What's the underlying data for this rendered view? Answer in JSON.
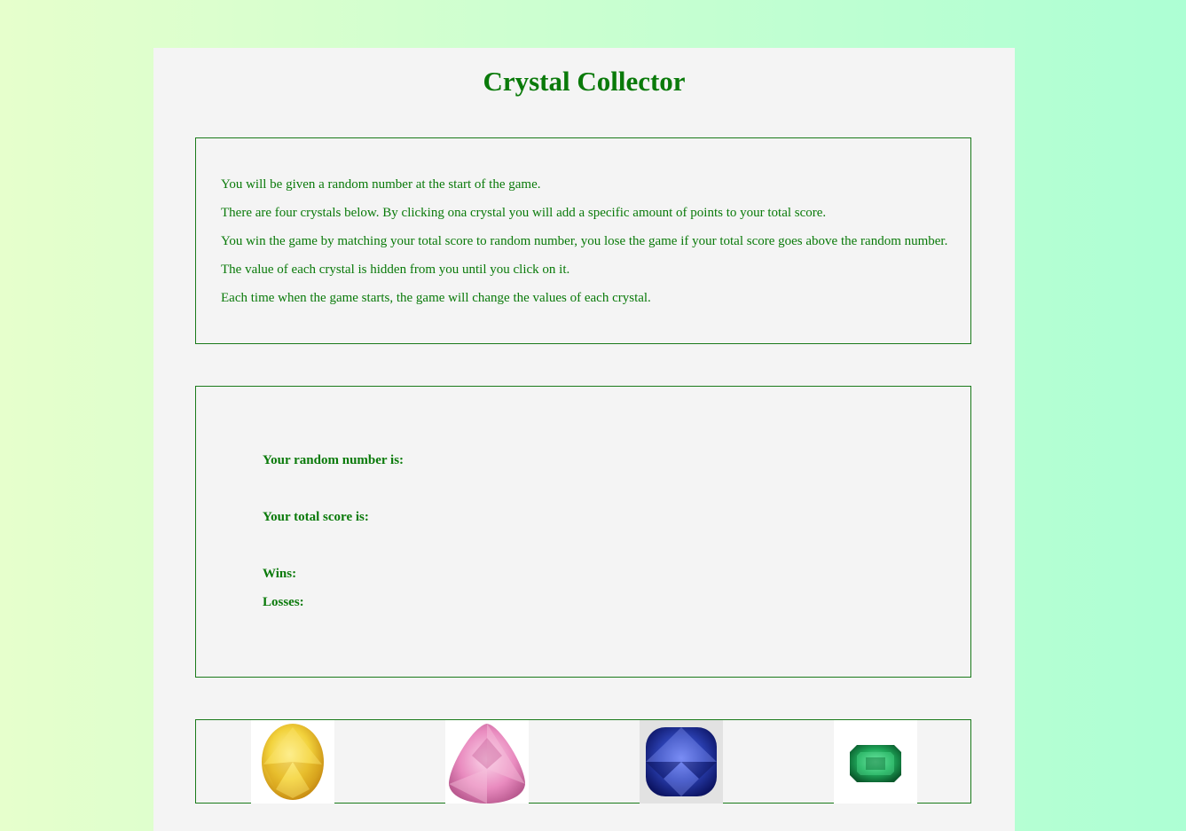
{
  "title": "Crystal Collector",
  "rules": [
    "You will be given a random number at the start of the game.",
    "There are four crystals below. By clicking ona crystal you will add a specific amount of points to your total score.",
    "You win the game by matching your total score to random number, you lose the game if your total score goes above the random number.",
    "The value of each crystal is hidden from you until you click on it.",
    "Each time when the game starts, the game will change the values of each crystal."
  ],
  "stats": {
    "random_label": "Your random number is:",
    "total_label": "Your total score is:",
    "wins_label": "Wins:",
    "losses_label": "Losses:"
  },
  "crystals": [
    {
      "icon": "yellow-gem-icon",
      "color": "#f2d23c"
    },
    {
      "icon": "pink-gem-icon",
      "color": "#e98bbf"
    },
    {
      "icon": "blue-gem-icon",
      "color": "#2a3fb0"
    },
    {
      "icon": "green-gem-icon",
      "color": "#1fa85a"
    }
  ],
  "colors": {
    "text": "#0a7a0a",
    "border": "#1a7a1a",
    "panel": "#f4f4f4"
  }
}
